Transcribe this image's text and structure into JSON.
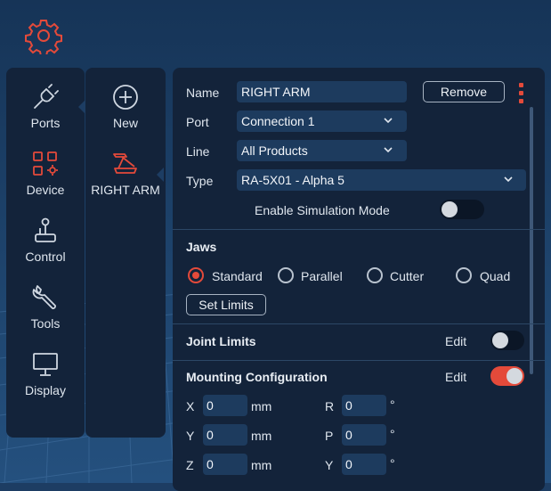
{
  "colors": {
    "accent": "#e44a3a",
    "panel": "#13233a",
    "background": "#1d3d63",
    "field": "#1d3b5e"
  },
  "top_icon": "gear-icon",
  "nav": {
    "items": [
      {
        "label": "Ports",
        "icon": "plug-icon"
      },
      {
        "label": "Device",
        "icon": "device-grid-icon",
        "active": true
      },
      {
        "label": "Control",
        "icon": "joystick-icon"
      },
      {
        "label": "Tools",
        "icon": "wrench-icon"
      },
      {
        "label": "Display",
        "icon": "monitor-icon"
      }
    ]
  },
  "devices": {
    "new_label": "New",
    "items": [
      {
        "label": "RIGHT ARM",
        "icon": "robot-arm-icon",
        "active": true
      }
    ]
  },
  "form": {
    "name_label": "Name",
    "name_value": "RIGHT ARM",
    "remove_label": "Remove",
    "port_label": "Port",
    "port_value": "Connection 1",
    "line_label": "Line",
    "line_value": "All Products",
    "type_label": "Type",
    "type_value": "RA-5X01 - Alpha 5",
    "simulation_label": "Enable Simulation Mode",
    "simulation_enabled": false
  },
  "jaws": {
    "title": "Jaws",
    "options": [
      "Standard",
      "Parallel",
      "Cutter",
      "Quad"
    ],
    "selected": "Standard",
    "set_limits_label": "Set Limits"
  },
  "joint_limits": {
    "title": "Joint Limits",
    "edit_label": "Edit",
    "enabled": false
  },
  "mounting": {
    "title": "Mounting Configuration",
    "edit_label": "Edit",
    "enabled": true,
    "position": [
      {
        "axis": "X",
        "value": "0",
        "unit": "mm"
      },
      {
        "axis": "Y",
        "value": "0",
        "unit": "mm"
      },
      {
        "axis": "Z",
        "value": "0",
        "unit": "mm"
      }
    ],
    "rotation": [
      {
        "axis": "R",
        "value": "0",
        "unit": "°"
      },
      {
        "axis": "P",
        "value": "0",
        "unit": "°"
      },
      {
        "axis": "Y",
        "value": "0",
        "unit": "°"
      }
    ]
  }
}
